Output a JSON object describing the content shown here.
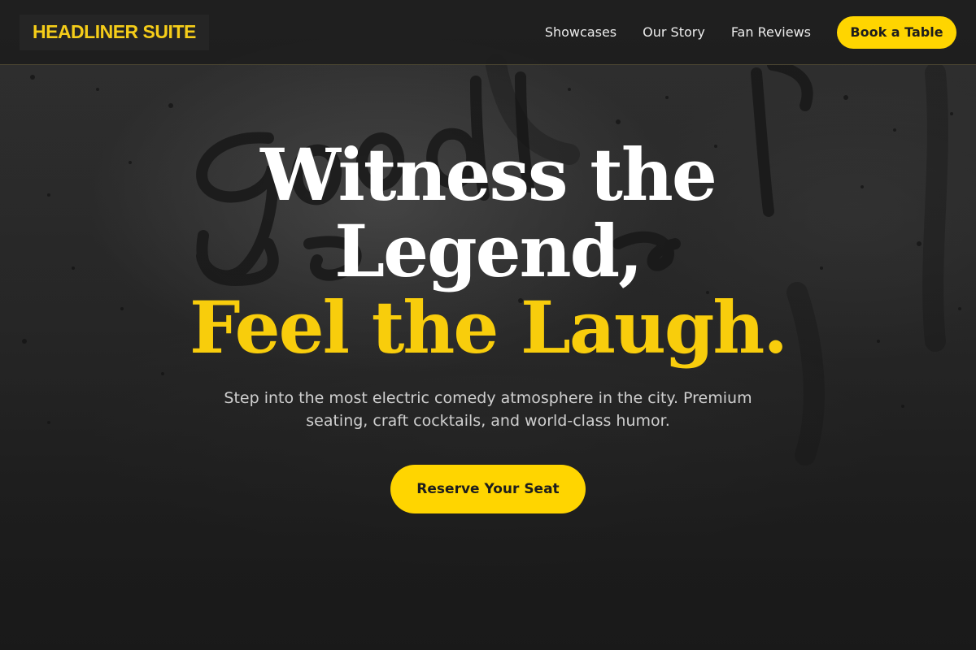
{
  "colors": {
    "accent": "#ffd500",
    "brand_text": "#f5cd19",
    "navbar_bg": "#1e1e1e",
    "headline_white": "#ffffff",
    "headline_accent": "#f8cd0c",
    "subtitle": "#cfcfcf"
  },
  "navbar": {
    "brand": "HEADLINER SUITE",
    "links": [
      {
        "label": "Showcases"
      },
      {
        "label": "Our Story"
      },
      {
        "label": "Fan Reviews"
      }
    ],
    "cta_label": "Book a Table"
  },
  "hero": {
    "headline_line1": "Witness the",
    "headline_line2": "Legend,",
    "headline_line3": "Feel the Laugh.",
    "subtitle": "Step into the most electric comedy atmosphere in the city. Premium seating, craft cocktails, and world-class humor.",
    "cta_label": "Reserve Your Seat"
  }
}
